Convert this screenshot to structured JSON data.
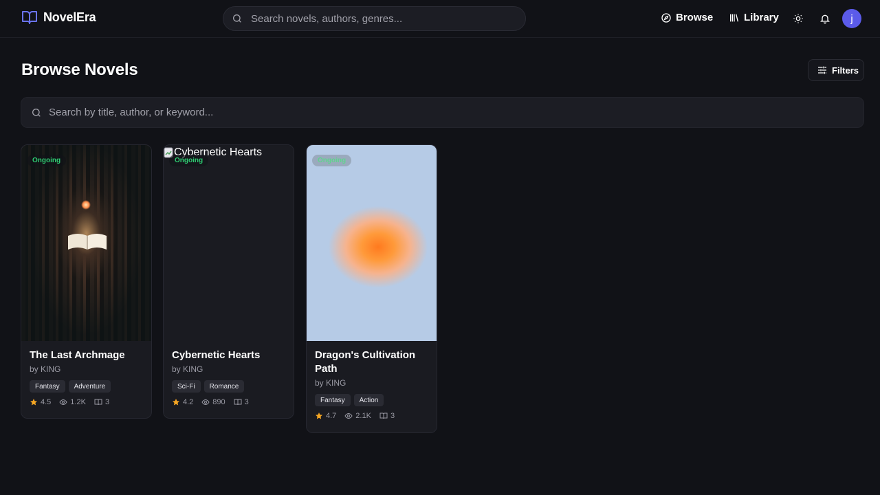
{
  "app": {
    "name": "NovelEra"
  },
  "header": {
    "search_placeholder": "Search novels, authors, genres...",
    "nav": {
      "browse": "Browse",
      "library": "Library"
    },
    "avatar_initial": "j"
  },
  "page": {
    "title": "Browse Novels",
    "filters_label": "Filters",
    "search_placeholder": "Search by title, author, or keyword..."
  },
  "colors": {
    "accent": "#5b5bea",
    "status_ongoing": "#2ecc71",
    "star": "#f5a623"
  },
  "novels": [
    {
      "title": "The Last Archmage",
      "author": "by KING",
      "status": "Ongoing",
      "tags": [
        "Fantasy",
        "Adventure"
      ],
      "rating": "4.5",
      "views": "1.2K",
      "chapters": "3",
      "cover_alt": ""
    },
    {
      "title": "Cybernetic Hearts",
      "author": "by KING",
      "status": "Ongoing",
      "tags": [
        "Sci-Fi",
        "Romance"
      ],
      "rating": "4.2",
      "views": "890",
      "chapters": "3",
      "cover_alt": "Cybernetic Hearts"
    },
    {
      "title": "Dragon's Cultivation Path",
      "author": "by KING",
      "status": "Ongoing",
      "tags": [
        "Fantasy",
        "Action"
      ],
      "rating": "4.7",
      "views": "2.1K",
      "chapters": "3",
      "cover_alt": ""
    }
  ]
}
